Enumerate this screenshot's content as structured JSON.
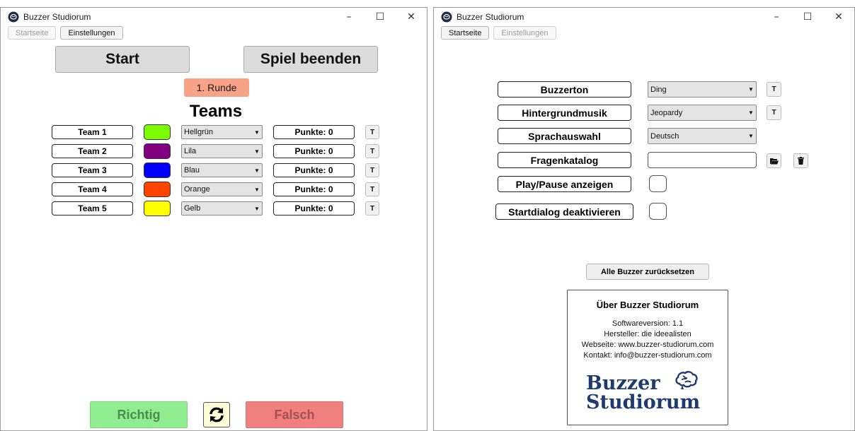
{
  "windowA": {
    "title": "Buzzer Studiorum",
    "controls": {
      "minimize": "–",
      "maximize": "☐",
      "close": "✕"
    },
    "nav": {
      "home": "Startseite",
      "settings": "Einstellungen"
    },
    "start_label": "Start",
    "end_label": "Spiel beenden",
    "round_label": "1. Runde",
    "teams_heading": "Teams",
    "teams": [
      {
        "name": "Team 1",
        "color": "#7cfc00",
        "color_name": "Hellgrün",
        "points": "Punkte: 0",
        "t": "T"
      },
      {
        "name": "Team 2",
        "color": "#800080",
        "color_name": "Lila",
        "points": "Punkte: 0",
        "t": "T"
      },
      {
        "name": "Team 3",
        "color": "#0000ff",
        "color_name": "Blau",
        "points": "Punkte: 0",
        "t": "T"
      },
      {
        "name": "Team 4",
        "color": "#ff4500",
        "color_name": "Orange",
        "points": "Punkte: 0",
        "t": "T"
      },
      {
        "name": "Team 5",
        "color": "#ffff00",
        "color_name": "Gelb",
        "points": "Punkte: 0",
        "t": "T"
      }
    ],
    "correct_label": "Richtig",
    "wrong_label": "Falsch"
  },
  "windowB": {
    "title": "Buzzer Studiorum",
    "controls": {
      "minimize": "–",
      "maximize": "☐",
      "close": "✕"
    },
    "nav": {
      "home": "Startseite",
      "settings": "Einstellungen"
    },
    "settings": {
      "buzzer_tone": {
        "label": "Buzzerton",
        "value": "Ding",
        "t": "T"
      },
      "background_music": {
        "label": "Hintergrundmusik",
        "value": "Jeopardy",
        "t": "T"
      },
      "language": {
        "label": "Sprachauswahl",
        "value": "Deutsch"
      },
      "question_catalog": {
        "label": "Fragenkatalog",
        "value": ""
      },
      "show_play_pause": {
        "label": "Play/Pause anzeigen"
      },
      "disable_start_dialog": {
        "label": "Startdialog deaktivieren"
      }
    },
    "reset_label": "Alle Buzzer zurücksetzen",
    "about": {
      "title": "Über Buzzer Studiorum",
      "version": "Softwareversion: 1.1",
      "maker": "Hersteller: die ideealisten",
      "website": "Webseite: www.buzzer-studiorum.com",
      "contact": "Kontakt: info@buzzer-studiorum.com",
      "logo_line1": "Buzzer",
      "logo_line2": "Studiorum",
      "logo_color": "#1f3a6e"
    }
  }
}
